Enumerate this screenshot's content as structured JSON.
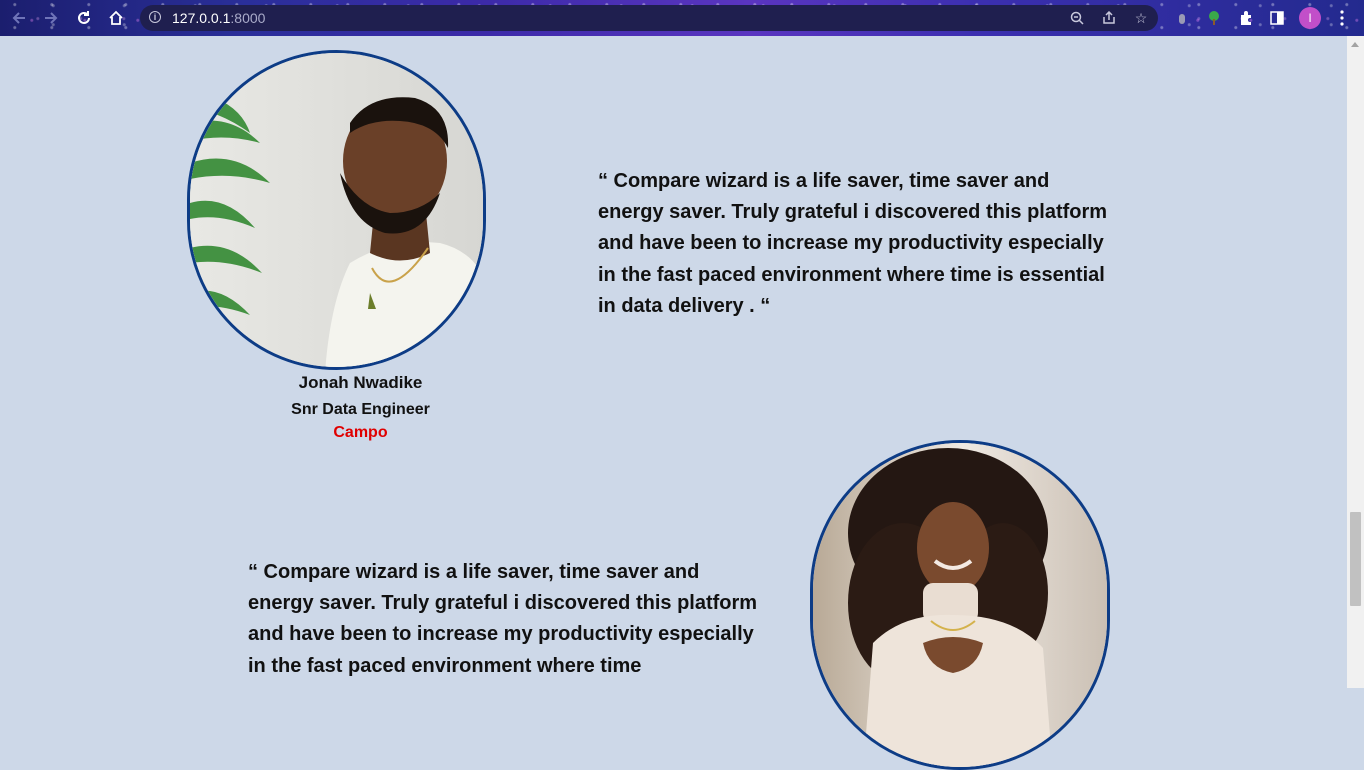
{
  "browser": {
    "url_host": "127.0.0.1",
    "url_port": ":8000",
    "profile_initial": "I",
    "icons": {
      "back": "back-arrow-icon",
      "forward": "forward-arrow-icon",
      "reload": "reload-icon",
      "home": "home-icon",
      "zoom": "zoom-icon",
      "share": "share-icon",
      "bookmark": "star-icon",
      "extensions": "puzzle-icon",
      "side_panel": "side-panel-icon",
      "menu": "kebab-menu-icon"
    }
  },
  "testimonials": [
    {
      "quote": "“ Compare wizard is a life saver, time saver and energy saver. Truly grateful i discovered this platform and have been to increase my productivity especially in the fast paced environment where time is essential in data delivery . “",
      "name": "Jonah Nwadike",
      "role": "Snr Data Engineer",
      "company": "Campo"
    },
    {
      "quote": "“ Compare wizard is a life saver, time saver and energy saver. Truly grateful i discovered this platform and have been to increase my productivity especially in the fast paced environment where time"
    }
  ],
  "colors": {
    "page_background": "#cdd8e8",
    "frame_border": "#0d3c86",
    "company_text": "#e00000"
  }
}
